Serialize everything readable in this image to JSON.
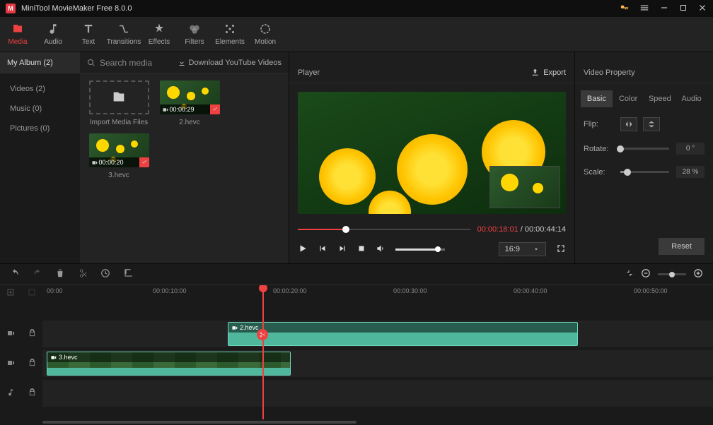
{
  "app": {
    "title": "MiniTool MovieMaker Free 8.0.0"
  },
  "toolbar": [
    {
      "id": "media",
      "label": "Media"
    },
    {
      "id": "audio",
      "label": "Audio"
    },
    {
      "id": "text",
      "label": "Text"
    },
    {
      "id": "transitions",
      "label": "Transitions"
    },
    {
      "id": "effects",
      "label": "Effects"
    },
    {
      "id": "filters",
      "label": "Filters"
    },
    {
      "id": "elements",
      "label": "Elements"
    },
    {
      "id": "motion",
      "label": "Motion"
    }
  ],
  "media": {
    "album_tab": "My Album (2)",
    "search_placeholder": "Search media",
    "download_label": "Download YouTube Videos",
    "sidebar": [
      {
        "label": "Videos (2)"
      },
      {
        "label": "Music (0)"
      },
      {
        "label": "Pictures (0)"
      }
    ],
    "import_label": "Import Media Files",
    "clips": [
      {
        "name": "2.hevc",
        "duration": "00:00:29"
      },
      {
        "name": "3.hevc",
        "duration": "00:00:20"
      }
    ]
  },
  "player": {
    "title": "Player",
    "export_label": "Export",
    "current_time": "00:00:18:01",
    "total_time": "00:00:44:14",
    "ratio": "16:9"
  },
  "props": {
    "title": "Video Property",
    "tabs": [
      "Basic",
      "Color",
      "Speed",
      "Audio"
    ],
    "flip_label": "Flip:",
    "rotate_label": "Rotate:",
    "rotate_value": "0 °",
    "scale_label": "Scale:",
    "scale_value": "28 %",
    "reset_label": "Reset"
  },
  "timeline": {
    "marks": [
      "00:00",
      "00:00:10:00",
      "00:00:20:00",
      "00:00:30:00",
      "00:00:40:00",
      "00:00:50:00"
    ],
    "clip1": "2.hevc",
    "clip2": "3.hevc"
  }
}
